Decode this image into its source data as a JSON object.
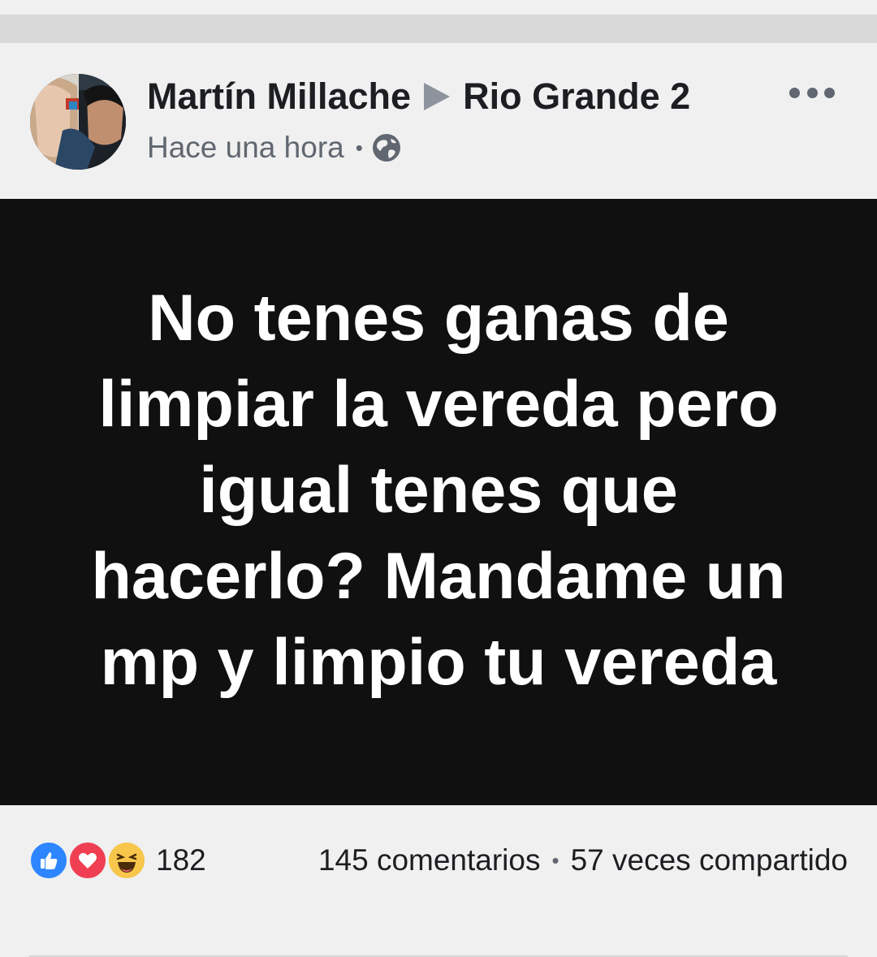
{
  "post": {
    "author": "Martín Millache",
    "group": "Rio Grande 2",
    "timestamp": "Hace una hora",
    "separator": "•",
    "privacy_icon": "globe-icon",
    "more_icon": "more-options-icon",
    "text": "No tenes ganas de limpiar la vereda pero igual tenes que hacerlo? Mandame un mp y limpio tu vereda",
    "background_color": "#101010",
    "text_color": "#ffffff"
  },
  "footer": {
    "reactions": [
      "like-icon",
      "love-icon",
      "haha-icon"
    ],
    "reaction_count": "182",
    "comments": "145 comentarios",
    "separator": "•",
    "shares": "57 veces compartido"
  },
  "colors": {
    "like": "#2d86ff",
    "love": "#f03e52",
    "haha": "#f7c64a"
  }
}
